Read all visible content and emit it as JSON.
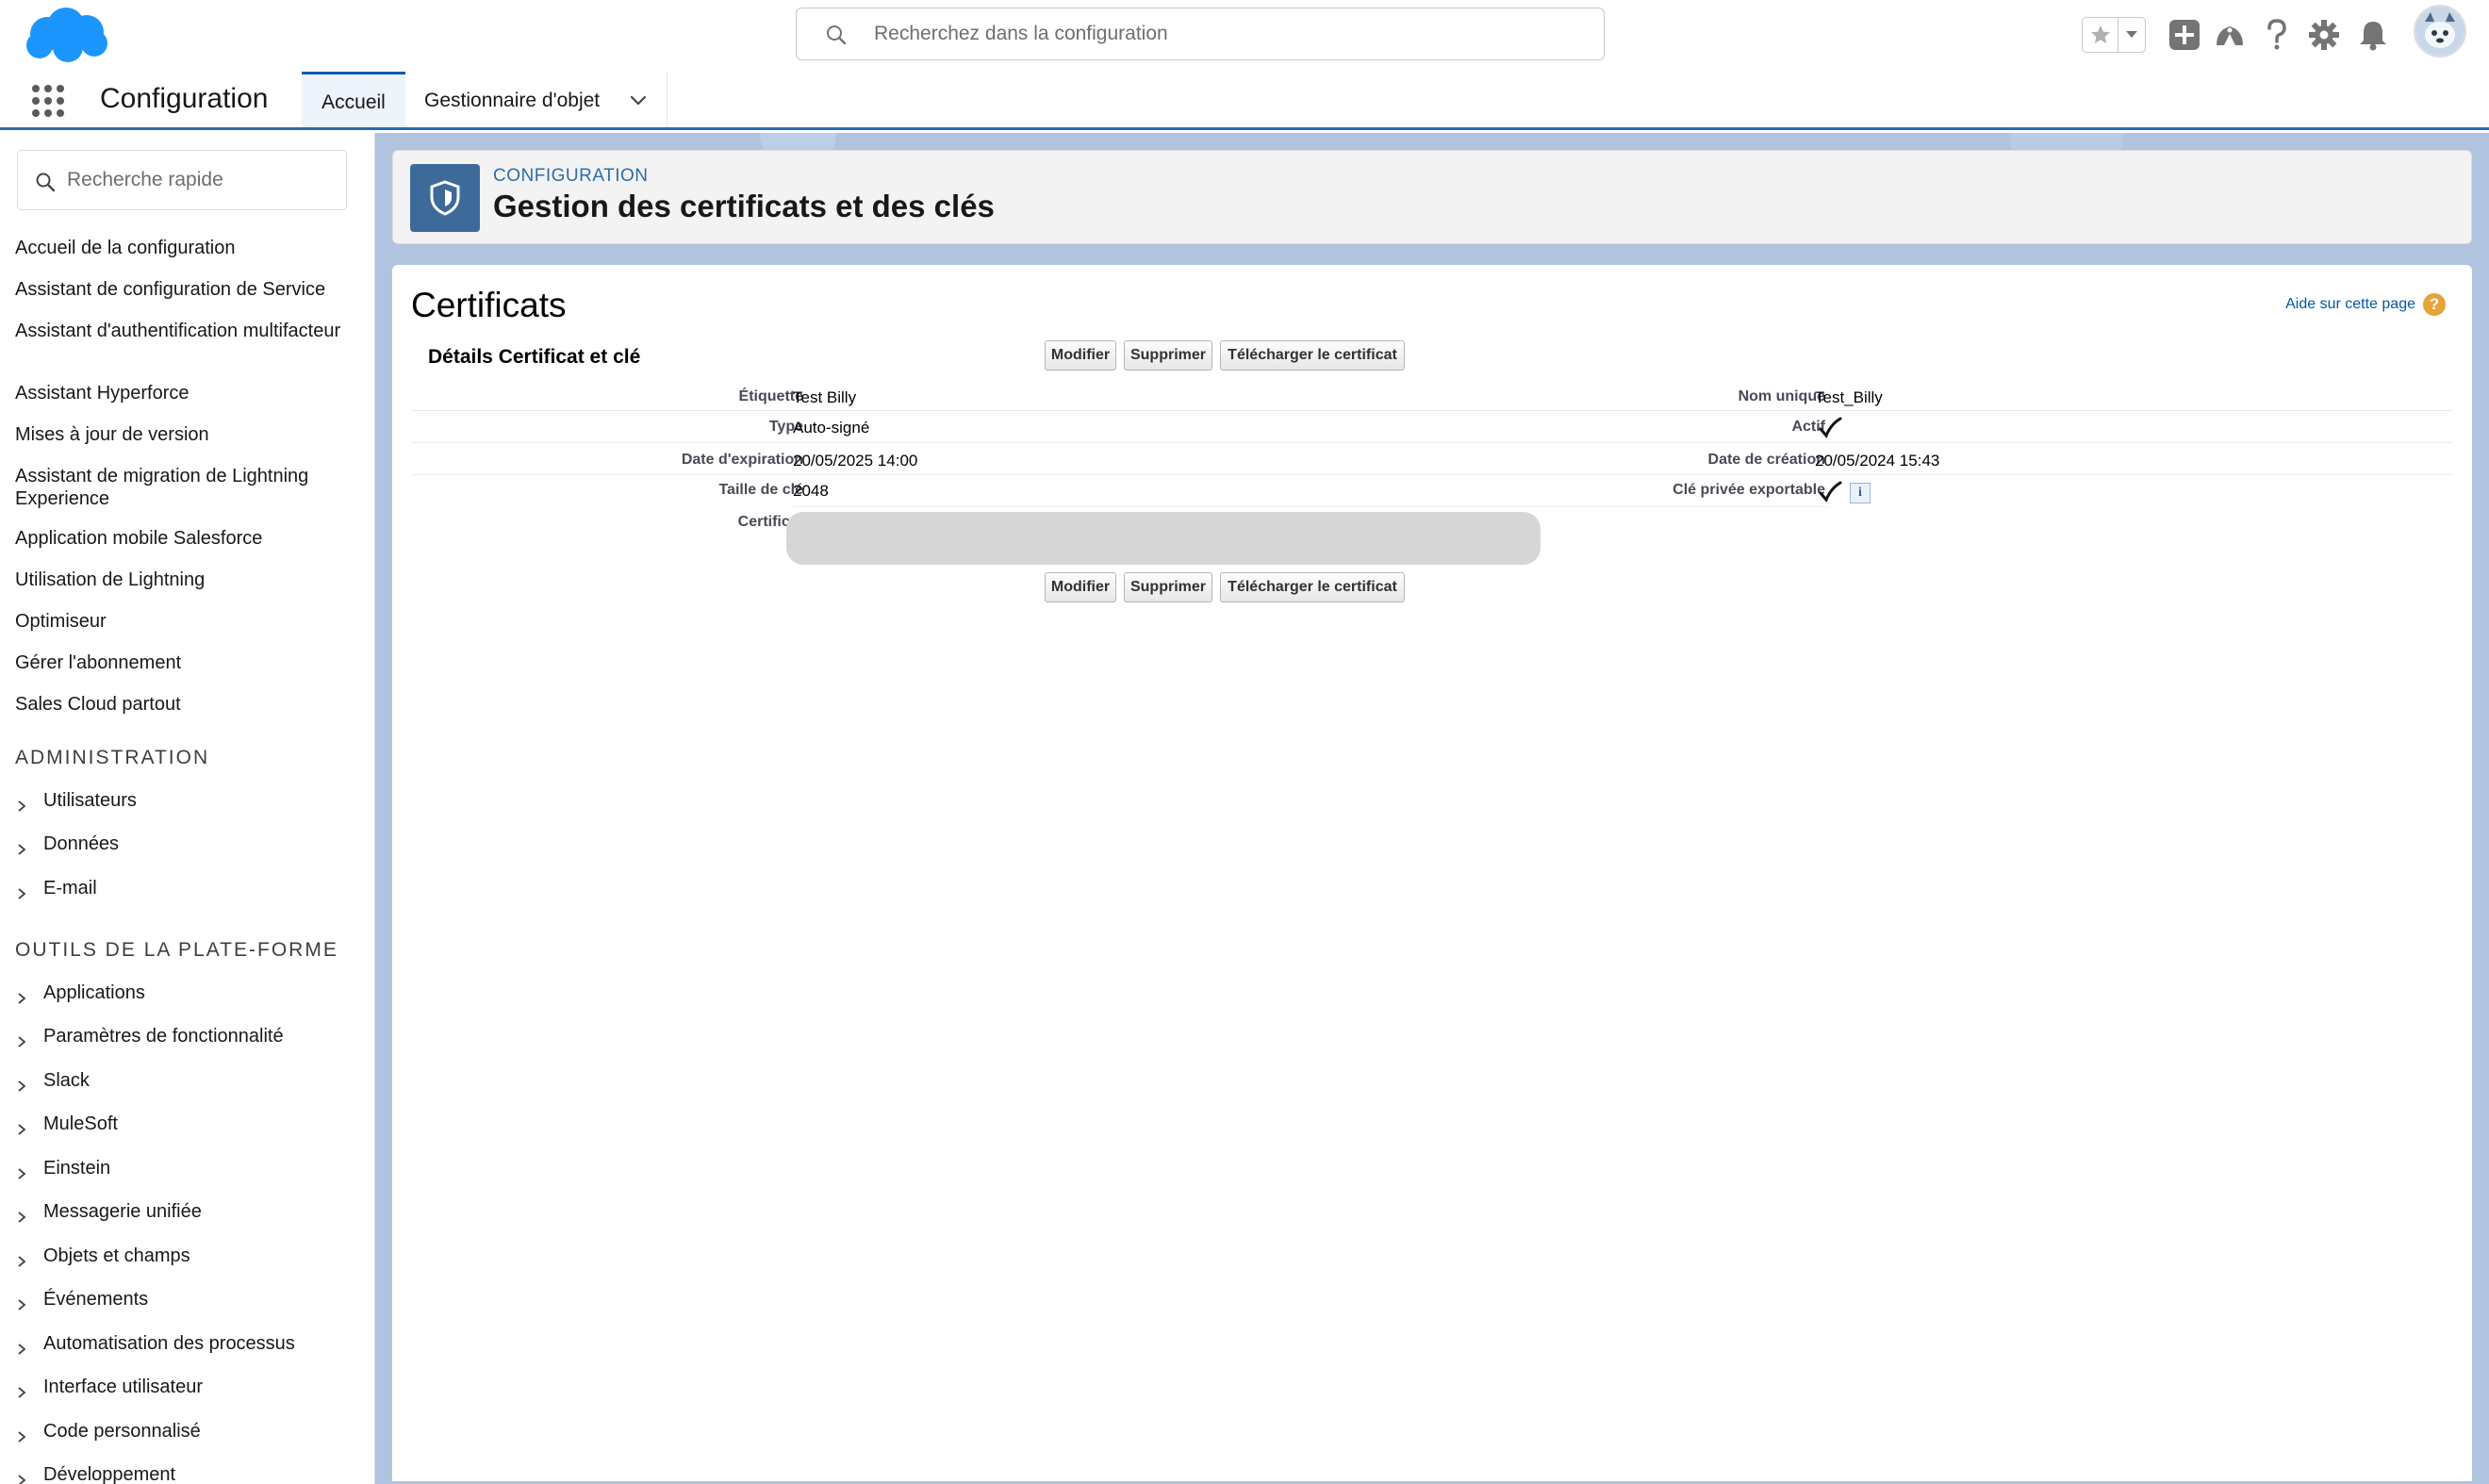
{
  "header": {
    "search_placeholder": "Recherchez dans la configuration"
  },
  "app_nav": {
    "app_name": "Configuration",
    "tabs": [
      {
        "label": "Accueil"
      },
      {
        "label": "Gestionnaire d'objet"
      }
    ]
  },
  "sidebar": {
    "quick_find_placeholder": "Recherche rapide",
    "links": [
      "Accueil de la configuration",
      "Assistant de configuration de Service",
      "Assistant d'authentification multifacteur",
      "Assistant Hyperforce",
      "Mises à jour de version",
      "Assistant de migration de Lightning Experience",
      "Application mobile Salesforce",
      "Utilisation de Lightning",
      "Optimiseur",
      "Gérer l'abonnement",
      "Sales Cloud partout"
    ],
    "admin_heading": "ADMINISTRATION",
    "admin_items": [
      "Utilisateurs",
      "Données",
      "E-mail"
    ],
    "platform_heading": "OUTILS DE LA PLATE-FORME",
    "platform_items": [
      "Applications",
      "Paramètres de fonctionnalité",
      "Slack",
      "MuleSoft",
      "Einstein",
      "Messagerie unifiée",
      "Objets et champs",
      "Événements",
      "Automatisation des processus",
      "Interface utilisateur",
      "Code personnalisé",
      "Développement"
    ]
  },
  "page_header": {
    "subtitle": "CONFIGURATION",
    "title": "Gestion des certificats et des clés"
  },
  "content": {
    "title": "Certificats",
    "help_link": "Aide sur cette page",
    "help_glyph": "?",
    "section_title": "Détails Certificat et clé",
    "buttons": {
      "edit": "Modifier",
      "delete": "Supprimer",
      "download": "Télécharger le certificat"
    },
    "fields": {
      "label_label": "Étiquette",
      "label_value": "Test Billy",
      "unique_name_label": "Nom unique",
      "unique_name_value": "Test_Billy",
      "type_label": "Type",
      "type_value": "Auto-signé",
      "active_label": "Actif",
      "expiration_label": "Date d'expiration",
      "expiration_value": "20/05/2025 14:00",
      "created_label": "Date de création",
      "created_value": "20/05/2024 15:43",
      "key_size_label": "Taille de clé",
      "key_size_value": "2048",
      "exportable_label": "Clé privée exportable",
      "certificate_label": "Certificat",
      "info_glyph": "i"
    }
  },
  "colors": {
    "brand_blue": "#0176d3",
    "nav_accent": "#0b5cab",
    "page_icon_bg": "#3e6a9a",
    "help_orange": "#e8a23a"
  }
}
